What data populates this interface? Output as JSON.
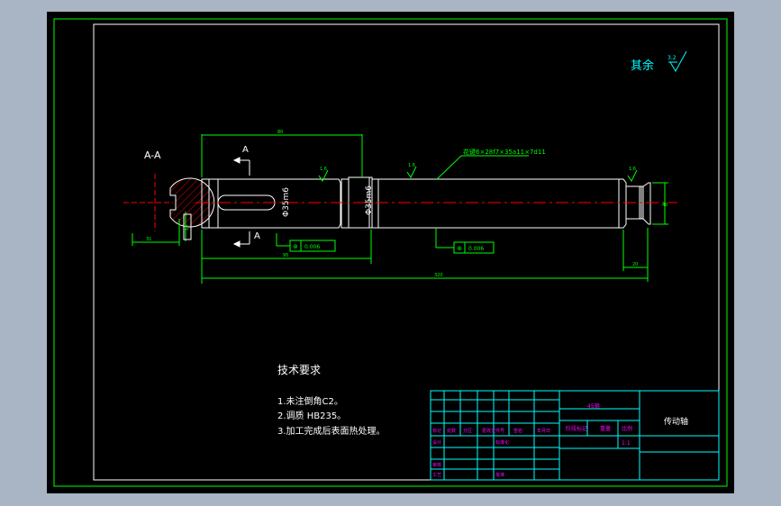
{
  "colors": {
    "background": "#000000",
    "app_bg": "#a9b5c4",
    "frame": "#ffffff",
    "outer_frame": "#00ff00",
    "geometry": "#ffffff",
    "dimension": "#00ff00",
    "centerline": "#ff0000",
    "hatch": "#ff0000",
    "text": "#ffffff",
    "magenta_text": "#ff00ff",
    "surface_text": "#00ffff",
    "title_table": "#00ffff"
  },
  "drawing": {
    "section_label": "A-A",
    "view_marker_top": "A",
    "view_marker_bottom": "A",
    "surface_note": "其余",
    "roughness_general": "3.2",
    "roughness_a": "1.6",
    "roughness_b": "1.6",
    "roughness_c": "1.6",
    "keyway_note": "花键6×28f7×35a11×7d11",
    "dim_left_diameter": "Φ35m6",
    "dim_mid_diameter": "Φ35m6",
    "dim_key_length": "80",
    "dim_left_section": "95",
    "dim_total_length": "320",
    "dim_right_length": "20",
    "dim_right_dia": "40",
    "dim_section_width": "10",
    "dim_section_depth": "31",
    "tolerance_left_symbol": "⊚",
    "tolerance_left_value": "0.006",
    "tolerance_mid_symbol": "⊚",
    "tolerance_mid_value": "0.006"
  },
  "requirements": {
    "title": "技术要求",
    "items": [
      "1.未注倒角C2。",
      "2.调质 HB235。",
      "3.加工完成后表面热处理。"
    ]
  },
  "title_block": {
    "material": "45钢",
    "part_name": "传动轴",
    "scale_label": "比例",
    "scale": "1:1",
    "weight_label": "重量",
    "stage_label": "阶段标记",
    "labels": [
      "标记",
      "处数",
      "分区",
      "更改文件号",
      "签名",
      "年月日"
    ],
    "design": "设计",
    "standardize": "标准化",
    "review": "审核",
    "process": "工艺",
    "approve": "批准"
  }
}
